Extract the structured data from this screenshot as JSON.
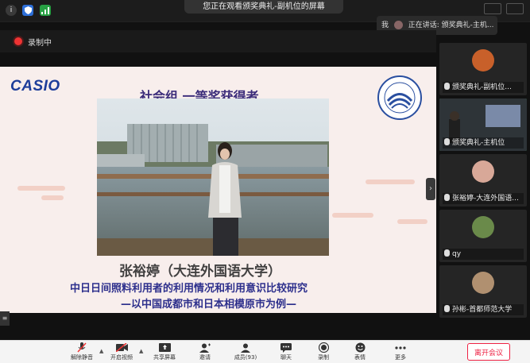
{
  "topbar": {
    "viewing": "您正在观看颁奖典礼-副机位的屏幕",
    "speaking_prefix": "我",
    "speaking": "正在讲话: 颁奖典礼-主机..."
  },
  "recording": {
    "label": "录制中"
  },
  "slide": {
    "brand": "CASIO",
    "award": "社会组 一等奖获得者",
    "name": "张裕婷（大连外国语大学）",
    "title_line1": "中日日间照料利用者的利用情况和利用意识比较研究",
    "title_line2": "—以中国成都市和日本相模原市为例—"
  },
  "sidebar": {
    "tiles": [
      {
        "label": "颁奖典礼-副机位...",
        "avatar_color": "#c8602a"
      },
      {
        "label": "颁奖典礼-主机位",
        "avatar_color": "#4a7a6a"
      },
      {
        "label": "张裕婷-大连外国语...",
        "avatar_color": "#d8a898"
      },
      {
        "label": "qy",
        "avatar_color": "#6a8a4a"
      },
      {
        "label": "孙彬-首都师范大学",
        "avatar_color": "#b09070"
      }
    ]
  },
  "toolbar": {
    "mute": "解除静音",
    "video": "开启视频",
    "share": "共享屏幕",
    "invite": "邀请",
    "members": "成员(93)",
    "chat": "聊天",
    "record": "录制",
    "reactions": "表情",
    "more": "更多",
    "end": "离开会议"
  },
  "colors": {
    "accent_green": "#3cc06a",
    "end_red": "#e22244",
    "rec_red": "#ee3333"
  }
}
